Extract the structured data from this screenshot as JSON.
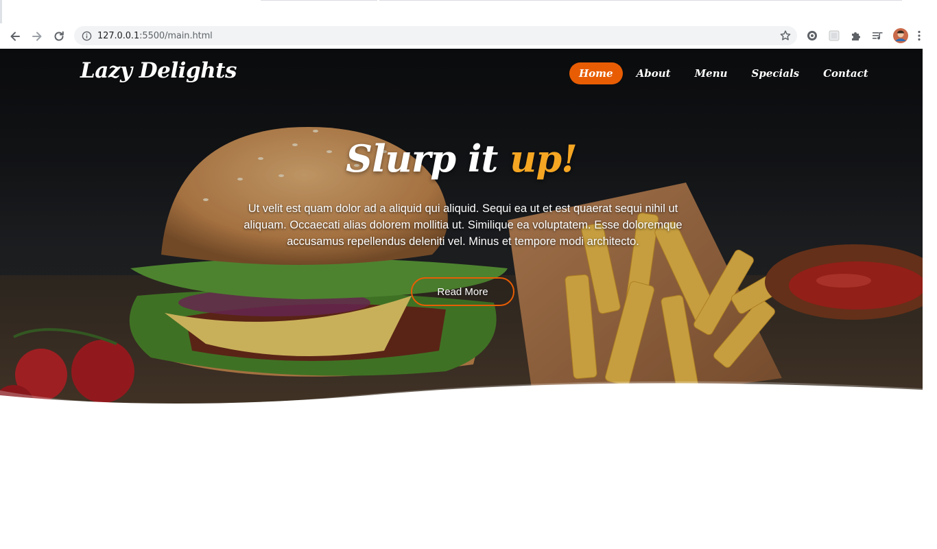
{
  "browser": {
    "url_host": "127.0.0.1",
    "url_rest": ":5500/main.html"
  },
  "site": {
    "logo": "Lazy Delights",
    "nav": [
      "Home",
      "About",
      "Menu",
      "Specials",
      "Contact"
    ],
    "active_nav": "Home"
  },
  "hero": {
    "headline_main": "Slurp it ",
    "headline_accent": "up!",
    "lead": "Ut velit est quam dolor ad a aliquid qui aliquid. Sequi ea ut et est quaerat sequi nihil ut aliquam. Occaecati alias dolorem mollitia ut. Similique ea voluptatem. Esse doloremque accusamus repellendus deleniti vel. Minus et tempore modi architecto.",
    "cta": "Read More"
  },
  "colors": {
    "accent_orange": "#e85d04",
    "headline_accent": "#f5a623",
    "omnibox_bg": "#f1f3f4"
  },
  "icons": [
    "back-icon",
    "forward-icon",
    "reload-icon",
    "info-icon",
    "star-icon",
    "extension-gear-icon",
    "extension-square-icon",
    "puzzle-icon",
    "media-queue-icon",
    "profile-avatar"
  ]
}
